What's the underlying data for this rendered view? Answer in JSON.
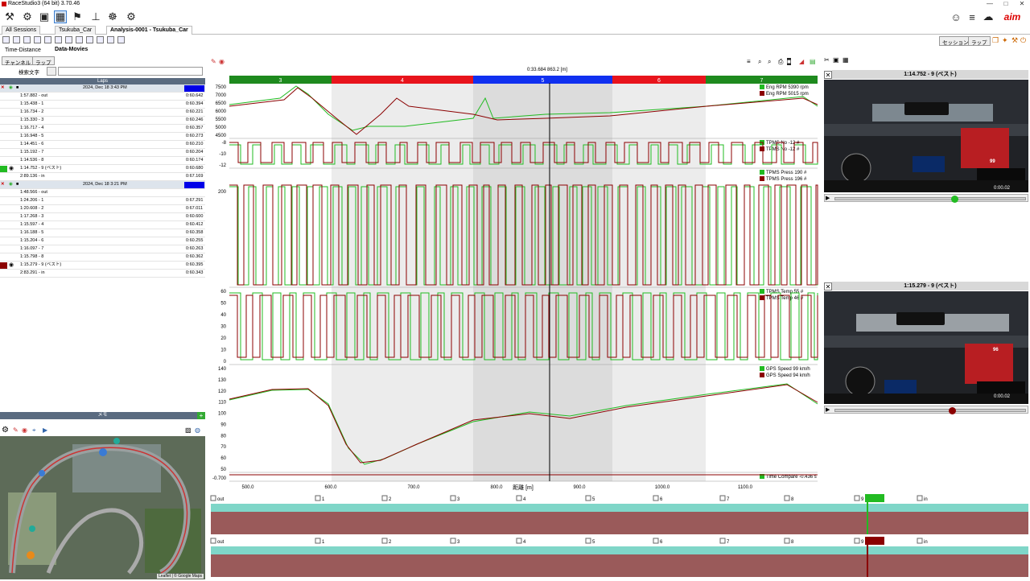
{
  "window": {
    "title": "RaceStudio3 (64 bit) 3.70.46",
    "controls": [
      "—",
      "□",
      "✕"
    ]
  },
  "toolbar": {
    "icons": [
      "wrench-icon",
      "gear-icon",
      "download-icon",
      "analysis-icon",
      "alert-icon",
      "device-icon",
      "config-icon",
      "settings-icon"
    ],
    "right_icons": [
      "user-icon",
      "wifi-icon",
      "cloud-icon",
      "brand-logo"
    ],
    "brand": "aim"
  },
  "tabs": [
    {
      "label": "All Sessions"
    },
    {
      "label": "Tsukuba_Car"
    },
    {
      "label": "Analysis-0001 - Tsukuba_Car"
    }
  ],
  "right_buttons": [
    {
      "label": "セッション"
    },
    {
      "label": "ラップ"
    }
  ],
  "subtabs": [
    {
      "label": "Time-Distance"
    },
    {
      "label": "Data-Movies"
    }
  ],
  "left": {
    "channel_btn": "チャンネル",
    "lap_btn": "ラップ",
    "search_label": "検索文字",
    "search_value": "",
    "laps_header": "Laps",
    "sessions": [
      {
        "date": "2024, Dec 18 3:43 PM",
        "color": "#0000e8",
        "laps": [
          {
            "name": "1:57.882 - out",
            "val": "0:60.642"
          },
          {
            "name": "1:15.438 - 1",
            "val": "0:60.394"
          },
          {
            "name": "1:16.734 - 2",
            "val": "0:60.221"
          },
          {
            "name": "1:15.330 - 3",
            "val": "0:60.246"
          },
          {
            "name": "1:16.717 - 4",
            "val": "0:60.357"
          },
          {
            "name": "1:16.948 - 5",
            "val": "0:60.273"
          },
          {
            "name": "1:14.451 - 6",
            "val": "0:60.210"
          },
          {
            "name": "1:15.192 - 7",
            "val": "0:60.204"
          },
          {
            "name": "1:14.536 - 8",
            "val": "0:60.174"
          },
          {
            "name": "1:14.752 - 9 (ベスト)",
            "val": "0:60.680",
            "swatch": "#22bb22",
            "eye": true
          },
          {
            "name": "2:89.136 - in",
            "val": "0:67.169"
          }
        ]
      },
      {
        "date": "2024, Dec 18 3:21 PM",
        "color": "#0000e8",
        "laps": [
          {
            "name": "1:48.566 - out",
            "val": ""
          },
          {
            "name": "1:24.206 - 1",
            "val": "0:67.291"
          },
          {
            "name": "1:20.608 - 2",
            "val": "0:67.011"
          },
          {
            "name": "1:17.268 - 3",
            "val": "0:60.600"
          },
          {
            "name": "1:15.597 - 4",
            "val": "0:60.412"
          },
          {
            "name": "1:16.188 - 5",
            "val": "0:60.358"
          },
          {
            "name": "1:15.204 - 6",
            "val": "0:60.255"
          },
          {
            "name": "1:16.097 - 7",
            "val": "0:60.263"
          },
          {
            "name": "1:15.798 - 8",
            "val": "0:60.362"
          },
          {
            "name": "1:15.279 - 9 (ベスト)",
            "val": "0:60.395",
            "swatch": "#8b0000",
            "eye": true
          },
          {
            "name": "2:83.291 - in",
            "val": "0:60.343"
          }
        ]
      }
    ],
    "memo_header": "メモ",
    "map_credit": "Leaflet | © Google Maps"
  },
  "graph": {
    "cursor_info": "0:33.684  863.2 [m]",
    "sectors": [
      {
        "label": "3",
        "color": "#1e8a1e"
      },
      {
        "label": "4",
        "color": "#e8141c"
      },
      {
        "label": "5",
        "color": "#1030f0"
      },
      {
        "label": "6",
        "color": "#e8141c"
      },
      {
        "label": "7",
        "color": "#1e8a1e"
      }
    ],
    "x_axis_label": "距離 [m]",
    "x_ticks": [
      "500.0",
      "600.0",
      "700.0",
      "800.0",
      "900.0",
      "1000.0",
      "1100.0"
    ],
    "panes": [
      {
        "ticks": [
          "7500",
          "7000",
          "6500",
          "6000",
          "5500",
          "5000",
          "4500"
        ],
        "legend": [
          {
            "name": "Eng RPM",
            "value": "5390",
            "unit": "rpm",
            "color": "#22bb22"
          },
          {
            "name": "Eng RPM",
            "value": "5015",
            "unit": "rpm",
            "color": "#8b0000"
          }
        ]
      },
      {
        "ticks": [
          "-8",
          "-10",
          "-12"
        ],
        "legend": [
          {
            "name": "TPMS No",
            "value": "-12",
            "unit": "#",
            "color": "#22bb22"
          },
          {
            "name": "TPMS No",
            "value": "-12",
            "unit": "#",
            "color": "#8b0000"
          }
        ]
      },
      {
        "ticks": [
          "200"
        ],
        "legend": [
          {
            "name": "TPMS Press",
            "value": "190",
            "unit": "#",
            "color": "#22bb22"
          },
          {
            "name": "TPMS Press",
            "value": "196",
            "unit": "#",
            "color": "#8b0000"
          }
        ]
      },
      {
        "ticks": [
          "60",
          "50",
          "40",
          "30",
          "20",
          "10",
          "0"
        ],
        "legend": [
          {
            "name": "TPMS Temp",
            "value": "55",
            "unit": "#",
            "color": "#22bb22"
          },
          {
            "name": "TPMS Temp",
            "value": "46",
            "unit": "#",
            "color": "#8b0000"
          }
        ]
      },
      {
        "ticks": [
          "140",
          "130",
          "120",
          "110",
          "100",
          "90",
          "80",
          "70",
          "60",
          "50"
        ],
        "legend": [
          {
            "name": "GPS Speed",
            "value": "99",
            "unit": "km/h",
            "color": "#22bb22"
          },
          {
            "name": "GPS Speed",
            "value": "94",
            "unit": "km/h",
            "color": "#8b0000"
          }
        ]
      },
      {
        "ticks": [
          "-0.700"
        ],
        "legend": [
          {
            "name": "Time Compare",
            "value": "-0.436",
            "unit": "s",
            "color": "#22bb22"
          }
        ]
      }
    ]
  },
  "lap_strips": [
    {
      "labels": [
        "out",
        "1",
        "2",
        "3",
        "4",
        "5",
        "6",
        "7",
        "8",
        "9",
        "in"
      ],
      "active": "9",
      "color": "#22bb22"
    },
    {
      "labels": [
        "out",
        "1",
        "2",
        "3",
        "4",
        "5",
        "6",
        "7",
        "8",
        "9",
        "in"
      ],
      "active": "9",
      "color": "#8b0000"
    }
  ],
  "videos": [
    {
      "title": "1:14.752 - 9 (ベスト)",
      "knob_color": "#22bb22",
      "progress": 0.62,
      "overlay": [
        "99",
        "0:00.02"
      ]
    },
    {
      "title": "1:15.279 - 9 (ベスト)",
      "knob_color": "#8b0000",
      "progress": 0.61,
      "overlay": [
        "96",
        "0:00.02"
      ]
    }
  ]
}
